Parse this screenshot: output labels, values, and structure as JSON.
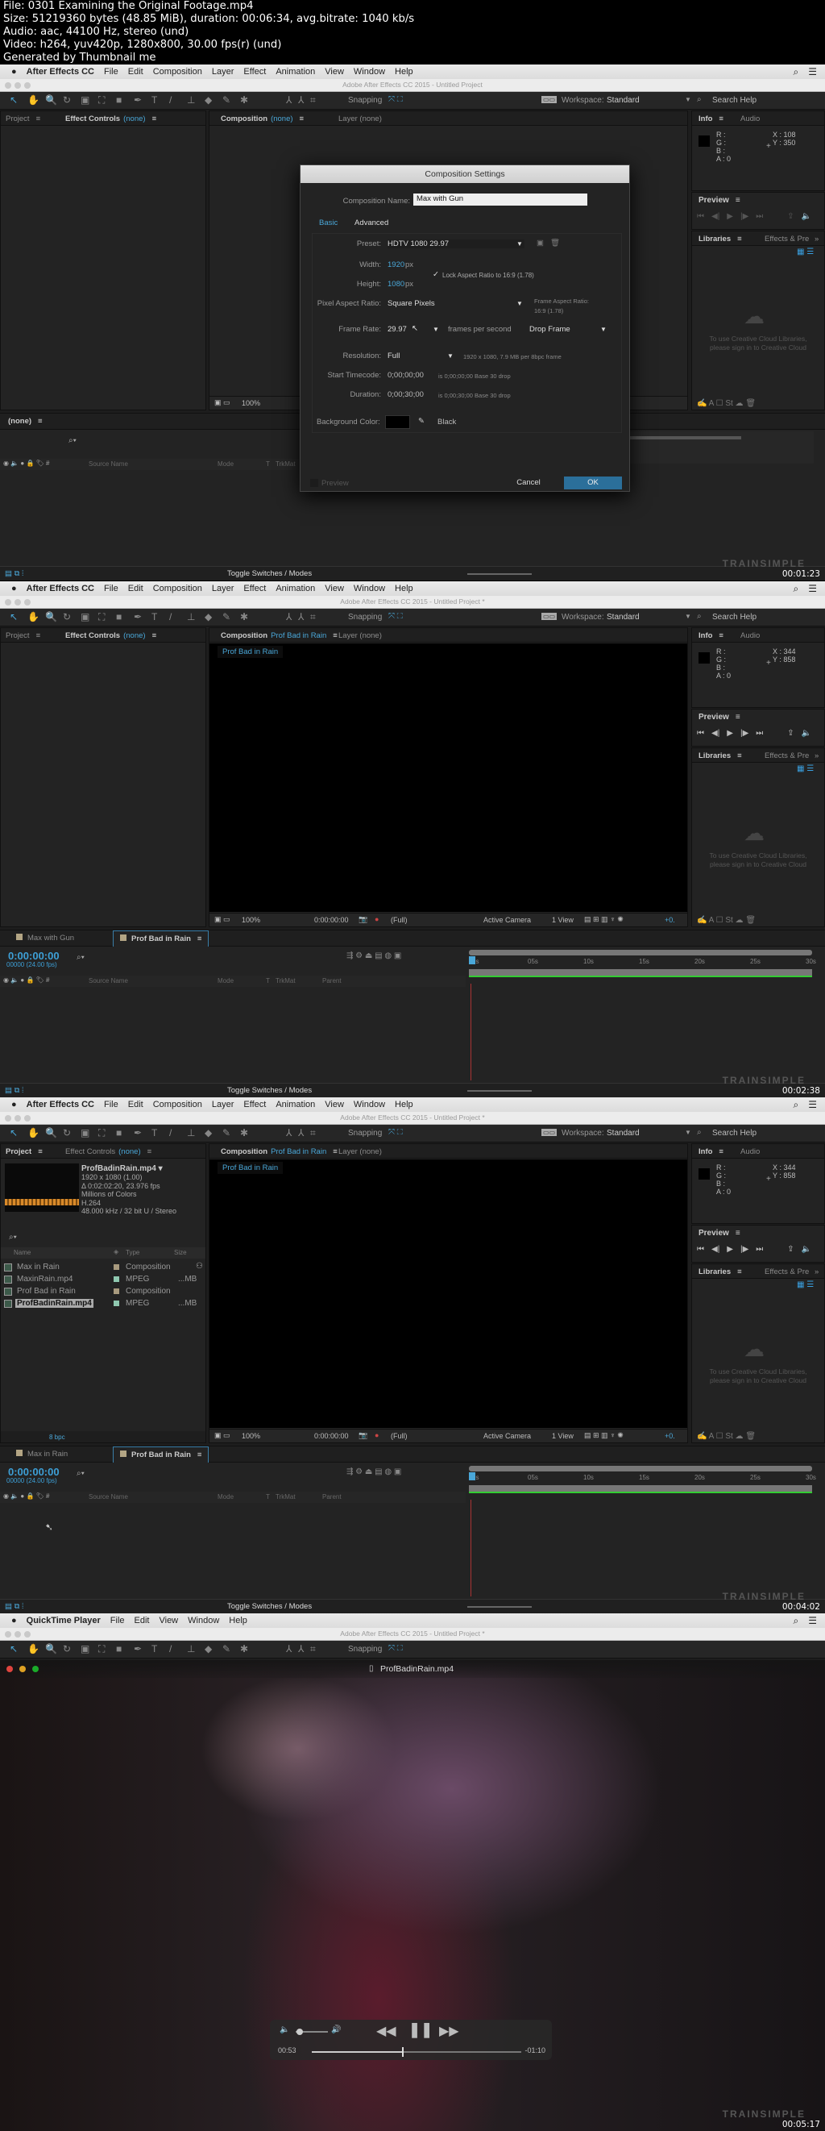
{
  "header": {
    "lines": [
      "File: 0301 Examining the Original Footage.mp4",
      "Size: 51219360 bytes (48.85 MiB), duration: 00:06:34, avg.bitrate: 1040 kb/s",
      "Audio: aac, 44100 Hz, stereo (und)",
      "Video: h264, yuv420p, 1280x800, 30.00 fps(r) (und)",
      "Generated by Thumbnail me"
    ]
  },
  "ae": {
    "app": "After Effects CC",
    "menu": [
      "File",
      "Edit",
      "Composition",
      "Layer",
      "Effect",
      "Animation",
      "View",
      "Window",
      "Help"
    ],
    "title": "Adobe After Effects CC 2015 - Untitled Project",
    "title_modified": "Adobe After Effects CC 2015 - Untitled Project *",
    "snapping": "Snapping",
    "workspace_label": "Workspace:",
    "workspace": "Standard",
    "search": "Search Help",
    "tab_project": "Project",
    "tab_effect_controls": "Effect Controls",
    "none": "(none)",
    "tab_composition": "Composition",
    "tab_layer": "Layer (none)",
    "tab_info": "Info",
    "tab_audio": "Audio",
    "info_labels": [
      "R :",
      "G :",
      "B :",
      "A : 0"
    ],
    "tab_preview": "Preview",
    "tab_libraries": "Libraries",
    "tab_effects": "Effects & Pre",
    "libraries_msg": [
      "To use Creative Cloud Libraries,",
      "please sign in to Creative Cloud"
    ],
    "zoom": "100%",
    "timecode_small": "0:00:00:00",
    "resolution": "(Full)",
    "camera": "Active Camera",
    "view": "1 View",
    "exposure": "+0.",
    "timeline_timecode": "0:00:00:00",
    "timeline_fps": "00000 (24.00 fps)",
    "columns": [
      "Source Name",
      "Mode",
      "T",
      "TrkMat",
      "Parent"
    ],
    "ruler": [
      "0s",
      "05s",
      "10s",
      "15s",
      "20s",
      "25s",
      "30s"
    ],
    "toggle": "Toggle Switches / Modes",
    "watermark": "TRAINSIMPLE"
  },
  "frames": [
    {
      "timestamp": "00:01:23",
      "info_x": "X : 108",
      "info_y": "Y : 350",
      "timeline_tabs": [
        "(none)"
      ]
    },
    {
      "timestamp": "00:02:38",
      "info_x": "X : 344",
      "info_y": "Y : 858",
      "comp_name": "Prof Bad in Rain",
      "timeline_tabs": [
        "Max with Gun",
        "Prof Bad in Rain"
      ]
    },
    {
      "timestamp": "00:04:02",
      "info_x": "X : 344",
      "info_y": "Y : 858",
      "comp_name": "Prof Bad in Rain",
      "timeline_tabs": [
        "Max in Rain",
        "Prof Bad in Rain"
      ],
      "project": {
        "file": "ProfBadinRain.mp4 ▾",
        "details": [
          "1920 x 1080 (1.00)",
          "Δ 0:02:02:20, 23.976 fps",
          "Millions of Colors",
          "H.264",
          "48.000 kHz / 32 bit U / Stereo"
        ],
        "columns": [
          "Name",
          "Type",
          "Size"
        ],
        "items": [
          {
            "name": "Max in Rain",
            "type": "Composition",
            "size": "",
            "color": "#a89a7e"
          },
          {
            "name": "MaxinRain.mp4",
            "type": "MPEG",
            "size": "...MB",
            "color": "#8fc8b0"
          },
          {
            "name": "Prof Bad in Rain",
            "type": "Composition",
            "size": "",
            "color": "#a89a7e"
          },
          {
            "name": "ProfBadinRain.mp4",
            "type": "MPEG",
            "size": "...MB",
            "color": "#8fc8b0",
            "selected": true
          }
        ],
        "bpc": "8 bpc"
      }
    },
    {
      "timestamp": "00:05:17"
    }
  ],
  "dialog": {
    "title": "Composition Settings",
    "name_label": "Composition Name:",
    "name_value": "Max with Gun",
    "tab_basic": "Basic",
    "tab_advanced": "Advanced",
    "preset_label": "Preset:",
    "preset": "HDTV 1080 29.97",
    "width_label": "Width:",
    "width": "1920",
    "height_label": "Height:",
    "height": "1080",
    "px": "px",
    "lock_aspect": "Lock Aspect Ratio to 16:9 (1.78)",
    "lock_checked": true,
    "par_label": "Pixel Aspect Ratio:",
    "par": "Square Pixels",
    "far_label": "Frame Aspect Ratio:",
    "far": "16:9 (1.78)",
    "fr_label": "Frame Rate:",
    "fr": "29.97",
    "fps_label": "frames per second",
    "drop": "Drop Frame",
    "res_label": "Resolution:",
    "res": "Full",
    "res_info": "1920 x 1080, 7.9 MB per 8bpc frame",
    "start_label": "Start Timecode:",
    "start": "0;00;00;00",
    "start_info": "is 0;00;00;00  Base 30  drop",
    "dur_label": "Duration:",
    "dur": "0;00;30;00",
    "dur_info": "is 0;00;30;00  Base 30  drop",
    "bg_label": "Background Color:",
    "bg_name": "Black",
    "bg_color": "#000000",
    "preview": "Preview",
    "cancel": "Cancel",
    "ok": "OK"
  },
  "quicktime": {
    "app": "QuickTime Player",
    "menu": [
      "File",
      "Edit",
      "View",
      "Window",
      "Help"
    ],
    "file": "ProfBadinRain.mp4",
    "elapsed": "00:53",
    "remaining": "-01:10",
    "progress": 0.43,
    "volume": 0.1
  },
  "colors": {
    "accent": "#4aa7d8",
    "panel": "#232323",
    "ok": "#2b6f9a"
  }
}
